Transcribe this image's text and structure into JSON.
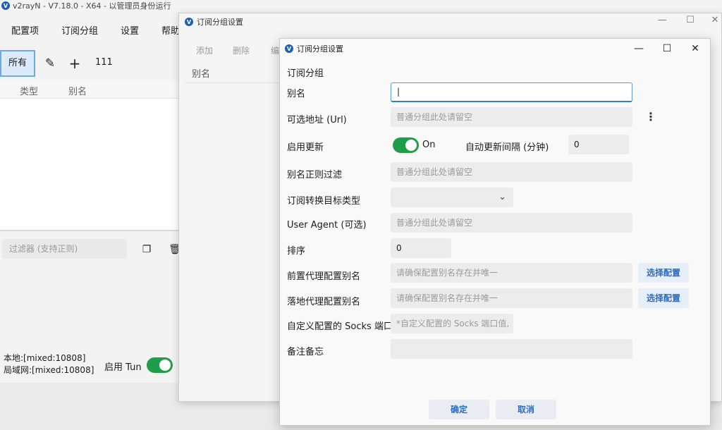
{
  "main": {
    "title": "v2rayN - V7.18.0 - X64 - 以管理员身份运行",
    "menu": [
      "配置项",
      "订阅分组",
      "设置",
      "帮助"
    ],
    "group_all": "所有",
    "group_name": "111",
    "columns": [
      "类型",
      "别名"
    ],
    "filter_placeholder": "过滤器 (支持正则)",
    "status_local": "本地:[mixed:10808]",
    "status_lan": "局域网:[mixed:10808]",
    "tun_label": "启用 Tun"
  },
  "sub_window": {
    "title": "订阅分组设置",
    "toolbar": [
      "添加",
      "删除",
      "编"
    ],
    "column": "别名"
  },
  "dialog": {
    "title": "订阅分组设置",
    "section": "订阅分组",
    "alias_label": "别名",
    "alias_value": "|",
    "url_label": "可选地址 (Url)",
    "url_placeholder": "普通分组此处请留空",
    "enable_update_label": "启用更新",
    "enable_update_state": "On",
    "auto_interval_label": "自动更新间隔 (分钟)",
    "auto_interval_value": "0",
    "regex_label": "别名正则过滤",
    "regex_placeholder": "普通分组此处请留空",
    "convert_label": "订阅转换目标类型",
    "convert_value": "",
    "ua_label": "User Agent (可选)",
    "ua_placeholder": "普通分组此处请留空",
    "sort_label": "排序",
    "sort_value": "0",
    "prev_proxy_label": "前置代理配置别名",
    "prev_proxy_placeholder": "请确保配置别名存在并唯一",
    "land_proxy_label": "落地代理配置别名",
    "land_proxy_placeholder": "请确保配置别名存在并唯一",
    "select_config": "选择配置",
    "socks_label": "自定义配置的 Socks 端口",
    "socks_placeholder": "*自定义配置的 Socks 端口值,",
    "memo_label": "备注备忘",
    "memo_value": "",
    "ok": "确定",
    "cancel": "取消"
  },
  "colors": {
    "accent": "#2a6bc4",
    "toggle_on": "#1e9e48",
    "selected_group_bg": "#dbeafc"
  }
}
